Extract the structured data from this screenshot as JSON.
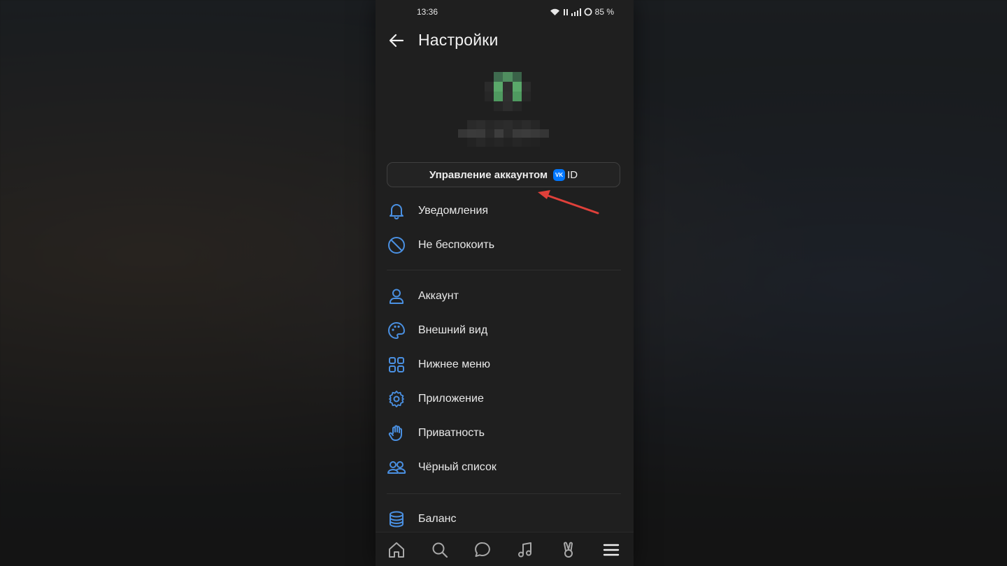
{
  "status_bar": {
    "time": "13:36",
    "battery": "85 %"
  },
  "header": {
    "title": "Настройки"
  },
  "account_button": {
    "label": "Управление аккаунтом",
    "badge": "VK",
    "suffix": "ID"
  },
  "menu": {
    "group1": [
      {
        "label": "Уведомления",
        "icon": "bell-icon"
      },
      {
        "label": "Не беспокоить",
        "icon": "do-not-disturb-icon"
      }
    ],
    "group2": [
      {
        "label": "Аккаунт",
        "icon": "person-icon"
      },
      {
        "label": "Внешний вид",
        "icon": "palette-icon"
      },
      {
        "label": "Нижнее меню",
        "icon": "grid-icon"
      },
      {
        "label": "Приложение",
        "icon": "gear-icon"
      },
      {
        "label": "Приватность",
        "icon": "hand-icon"
      },
      {
        "label": "Чёрный список",
        "icon": "users-icon"
      }
    ],
    "group3": [
      {
        "label": "Баланс",
        "icon": "database-icon"
      }
    ]
  },
  "tabbar": [
    "home-icon",
    "search-icon",
    "chat-icon",
    "music-icon",
    "clips-icon",
    "menu-icon"
  ],
  "colors": {
    "accent": "#4a90e2",
    "background": "#1f1f1f",
    "arrow": "#e0403a",
    "vk_blue": "#0077ff"
  }
}
